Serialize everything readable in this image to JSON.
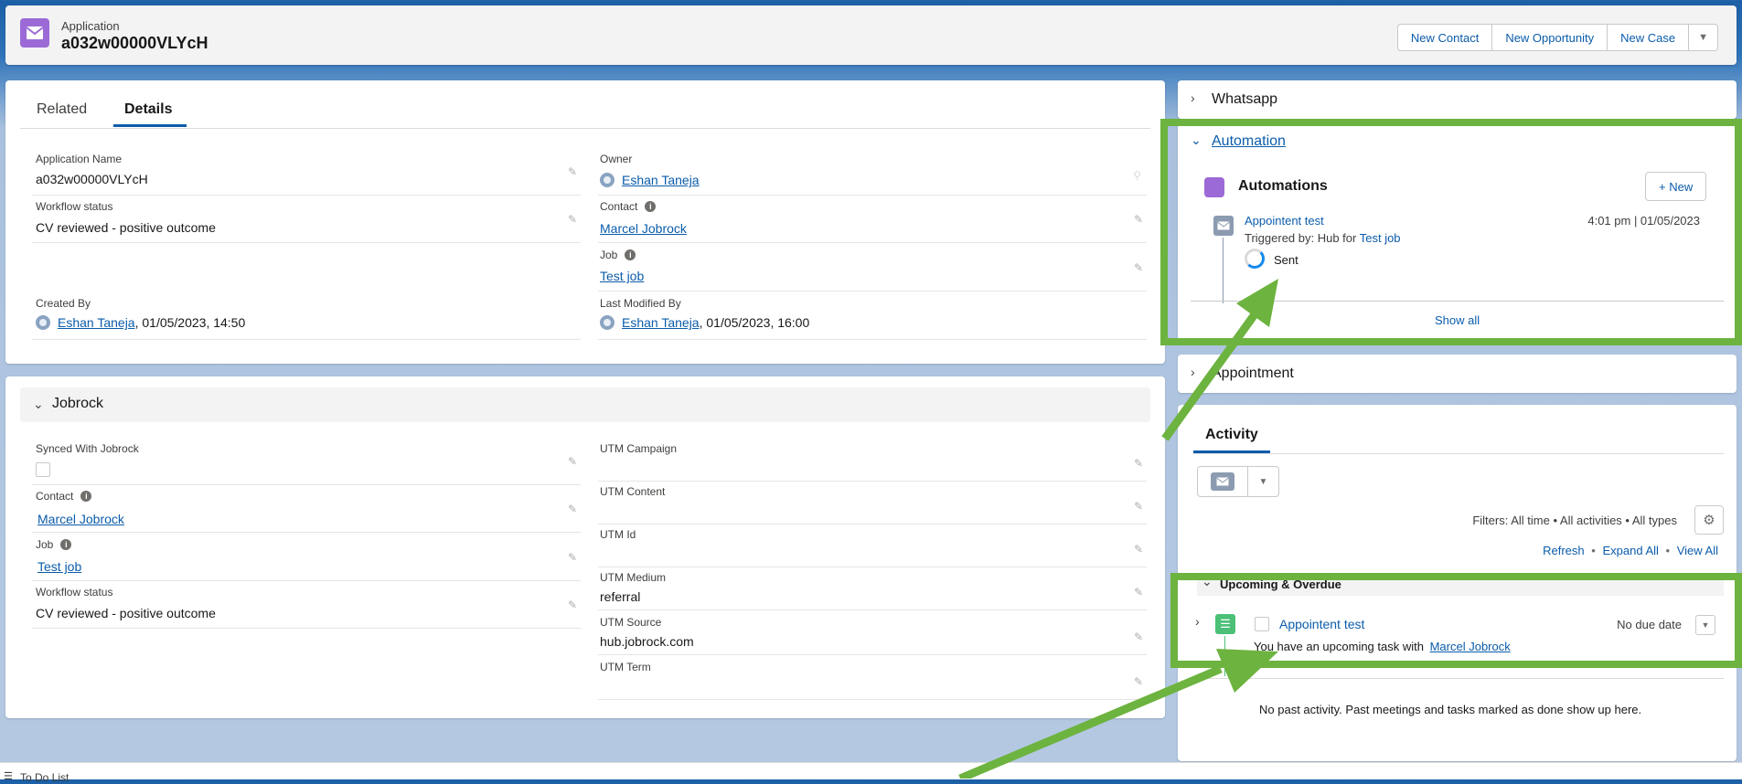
{
  "header": {
    "object_type": "Application",
    "record_name": "a032w00000VLYcH",
    "actions": [
      "New Contact",
      "New Opportunity",
      "New Case"
    ]
  },
  "tabs": [
    "Related",
    "Details"
  ],
  "active_tab": "Details",
  "details": {
    "application_name": {
      "label": "Application Name",
      "value": "a032w00000VLYcH"
    },
    "workflow_status": {
      "label": "Workflow status",
      "value": "CV reviewed - positive outcome"
    },
    "created_by": {
      "label": "Created By",
      "user": "Eshan Taneja",
      "date": ", 01/05/2023, 14:50"
    },
    "owner": {
      "label": "Owner",
      "value": "Eshan Taneja"
    },
    "contact": {
      "label": "Contact",
      "value": "Marcel Jobrock"
    },
    "job": {
      "label": "Job",
      "value": "Test job"
    },
    "last_modified_by": {
      "label": "Last Modified By",
      "user": "Eshan Taneja",
      "date": ", 01/05/2023, 16:00"
    }
  },
  "jobrock": {
    "section_title": "Jobrock",
    "synced": {
      "label": "Synced With Jobrock"
    },
    "contact": {
      "label": "Contact",
      "value": "Marcel Jobrock"
    },
    "job": {
      "label": "Job",
      "value": "Test job"
    },
    "workflow_status": {
      "label": "Workflow status",
      "value": "CV reviewed - positive outcome"
    },
    "utm_campaign": {
      "label": "UTM Campaign",
      "value": ""
    },
    "utm_content": {
      "label": "UTM Content",
      "value": ""
    },
    "utm_id": {
      "label": "UTM Id",
      "value": ""
    },
    "utm_medium": {
      "label": "UTM Medium",
      "value": "referral"
    },
    "utm_source": {
      "label": "UTM Source",
      "value": "hub.jobrock.com"
    },
    "utm_term": {
      "label": "UTM Term",
      "value": ""
    }
  },
  "right": {
    "whatsapp": "Whatsapp",
    "automation": "Automation",
    "automations_title": "Automations",
    "new_button": "+ New",
    "automation_item": {
      "name": "Appointent test",
      "time": "4:01 pm | 01/05/2023",
      "triggered_prefix": "Triggered by: Hub for ",
      "triggered_link": "Test job",
      "status": "Sent"
    },
    "show_all": "Show all",
    "appointment": "Appointment"
  },
  "activity": {
    "tab": "Activity",
    "filters": "Filters: All time • All activities • All types",
    "refresh": "Refresh",
    "expand_all": "Expand All",
    "view_all": "View All",
    "dot": "•",
    "section": "Upcoming & Overdue",
    "task_name": "Appointent test",
    "due": "No due date",
    "task_text": "You have an upcoming task with ",
    "task_contact": "Marcel Jobrock",
    "no_past": "No past activity. Past meetings and tasks marked as done show up here."
  },
  "footer": {
    "todo": "To Do List"
  },
  "colors": {
    "accent": "#0b5cab",
    "highlight": "#6db33f",
    "header_icon": "#9c6ad6"
  }
}
